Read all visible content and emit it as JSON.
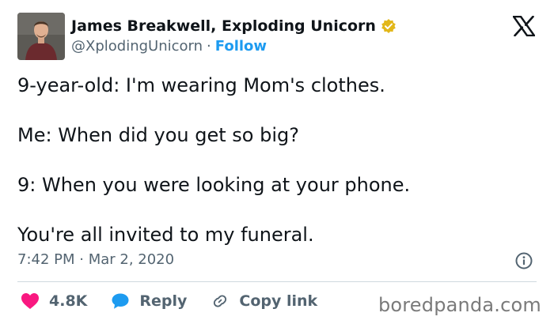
{
  "tweet": {
    "author_name": "James Breakwell, Exploding Unicorn",
    "handle": "@XplodingUnicorn",
    "separator": "·",
    "follow_label": "Follow",
    "lines": [
      "9-year-old: I'm wearing Mom's clothes.",
      "Me: When did you get so big?",
      "9: When you were looking at your phone.",
      "You're all invited to my funeral."
    ],
    "timestamp": "7:42 PM · Mar 2, 2020"
  },
  "actions": {
    "likes_count": "4.8K",
    "reply_label": "Reply",
    "copy_link_label": "Copy link"
  },
  "watermark": "boredpanda.com",
  "icons": {
    "verified": "verified-badge-icon",
    "x_logo": "x-logo-icon",
    "info": "info-icon",
    "heart": "heart-icon",
    "reply": "speech-bubble-icon",
    "link": "link-icon"
  },
  "colors": {
    "text": "#0f1419",
    "secondary": "#536471",
    "follow": "#1d9bf0",
    "heart": "#f91880",
    "reply_bubble": "#1d9bf0",
    "verified_gold": "#e2b719"
  }
}
